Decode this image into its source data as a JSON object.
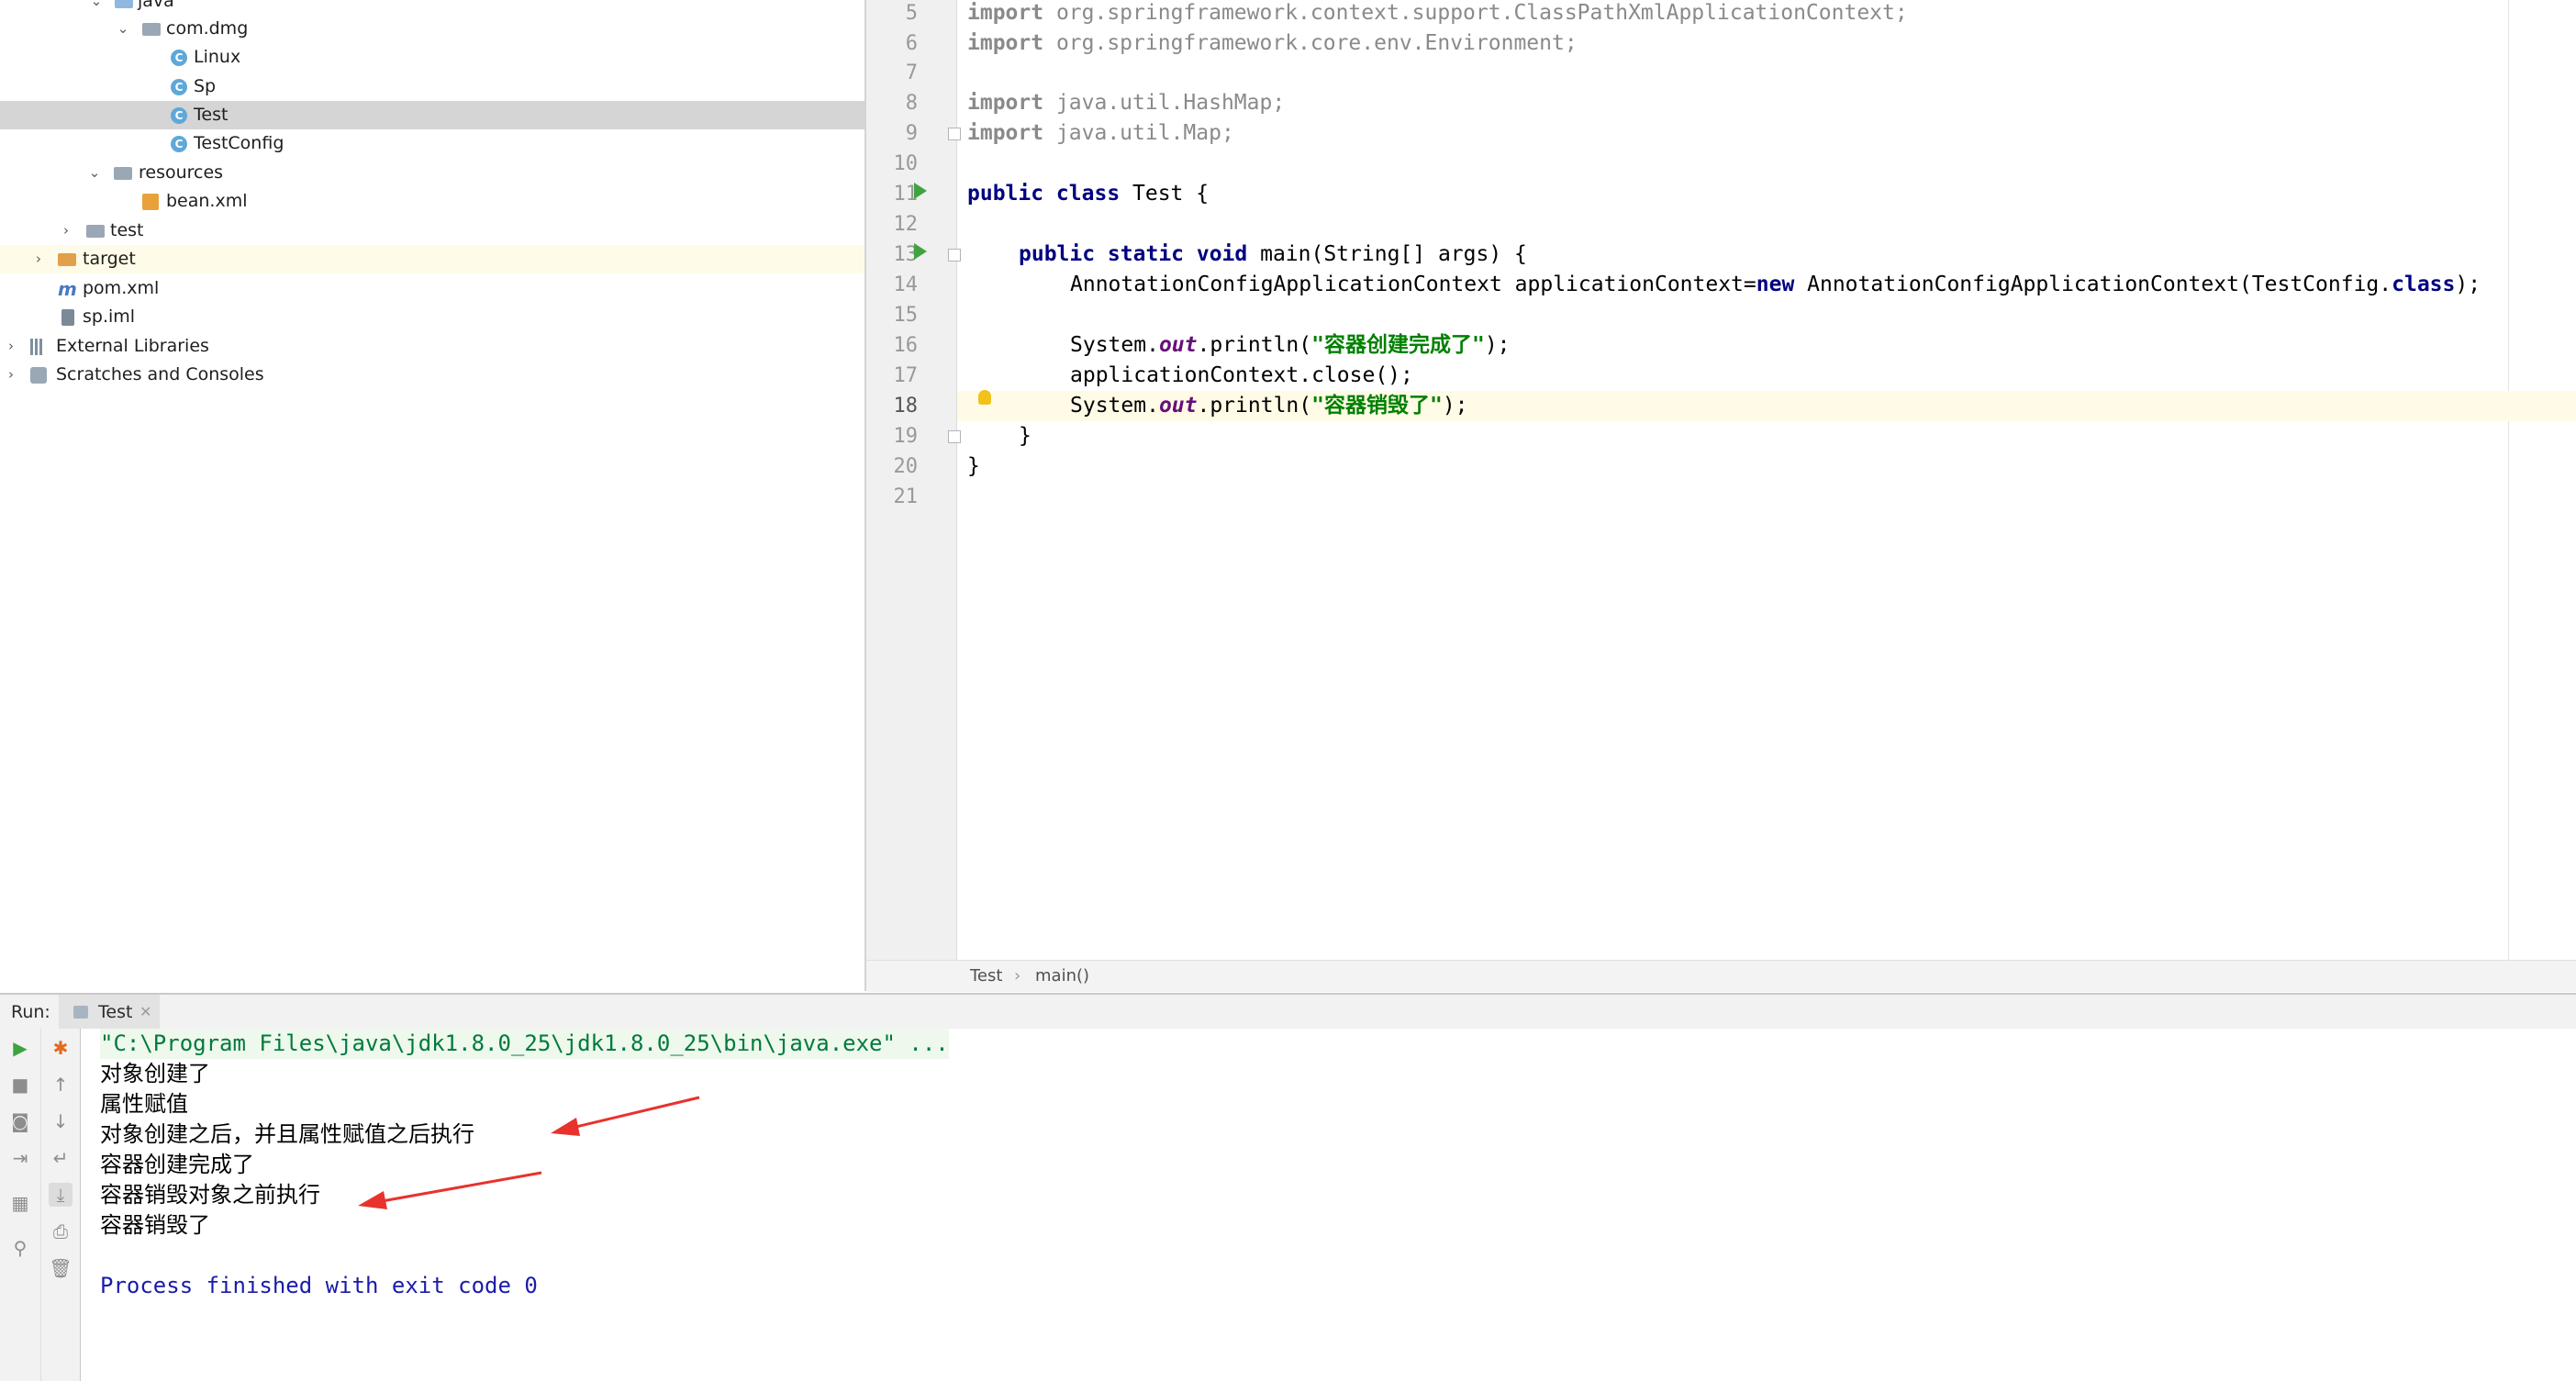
{
  "project_tree": {
    "items": [
      {
        "label": "java",
        "type": "folder-blue",
        "expanded": true
      },
      {
        "label": "com.dmg",
        "type": "package",
        "expanded": true
      },
      {
        "label": "Linux",
        "type": "class"
      },
      {
        "label": "Sp",
        "type": "class"
      },
      {
        "label": "Test",
        "type": "class",
        "selected": true
      },
      {
        "label": "TestConfig",
        "type": "class"
      },
      {
        "label": "resources",
        "type": "folder",
        "expanded": true
      },
      {
        "label": "bean.xml",
        "type": "xml"
      },
      {
        "label": "test",
        "type": "folder",
        "expanded": false
      },
      {
        "label": "target",
        "type": "folder-orange",
        "expanded": false
      },
      {
        "label": "pom.xml",
        "type": "maven"
      },
      {
        "label": "sp.iml",
        "type": "iml"
      },
      {
        "label": "External Libraries",
        "type": "library",
        "expanded": false
      },
      {
        "label": "Scratches and Consoles",
        "type": "scratches",
        "expanded": false
      }
    ]
  },
  "editor": {
    "line_numbers": [
      "5",
      "6",
      "7",
      "8",
      "9",
      "10",
      "11",
      "12",
      "13",
      "14",
      "15",
      "16",
      "17",
      "18",
      "19",
      "20",
      "21"
    ],
    "current_line": "18",
    "lines": {
      "l5_kw": "import",
      "l5_rest": " org.springframework.context.support.ClassPathXmlApplicationContext;",
      "l6_kw": "import",
      "l6_rest": " org.springframework.core.env.Environment;",
      "l8_kw": "import",
      "l8_rest": " java.util.HashMap;",
      "l9_kw": "import",
      "l9_rest": " java.util.Map;",
      "l11_kw": "public class",
      "l11_rest": " Test {",
      "l13_kw": "public static void",
      "l13_rest": " main(String[] args) {",
      "l14_a": "AnnotationConfigApplicationContext applicationContext=",
      "l14_kw": "new",
      "l14_b": " AnnotationConfigApplicationContext(TestConfig.",
      "l14_kw2": "class",
      "l14_c": ");",
      "l16_a": "System.",
      "l16_fld": "out",
      "l16_b": ".println(",
      "l16_str": "\"容器创建完成了\"",
      "l16_c": ");",
      "l17": "applicationContext.close();",
      "l18_a": "System.",
      "l18_fld": "out",
      "l18_b": ".println(",
      "l18_str": "\"容器销毁了\"",
      "l18_c": ");",
      "l19": "}",
      "l20": "}"
    }
  },
  "breadcrumb": {
    "class": "Test",
    "separator": "›",
    "method": "main()"
  },
  "run_panel": {
    "label": "Run:",
    "tab": "Test",
    "console": {
      "command": "\"C:\\Program Files\\java\\jdk1.8.0_25\\jdk1.8.0_25\\bin\\java.exe\" ...",
      "lines": [
        "对象创建了",
        "属性赋值",
        "对象创建之后，并且属性赋值之后执行",
        "容器创建完成了",
        "容器销毁对象之前执行",
        "容器销毁了"
      ],
      "finished": "Process finished with exit code 0"
    }
  },
  "colors": {
    "annotation_arrow": "#e8322d",
    "keyword": "#000080",
    "string": "#008000",
    "field": "#660e7a"
  }
}
